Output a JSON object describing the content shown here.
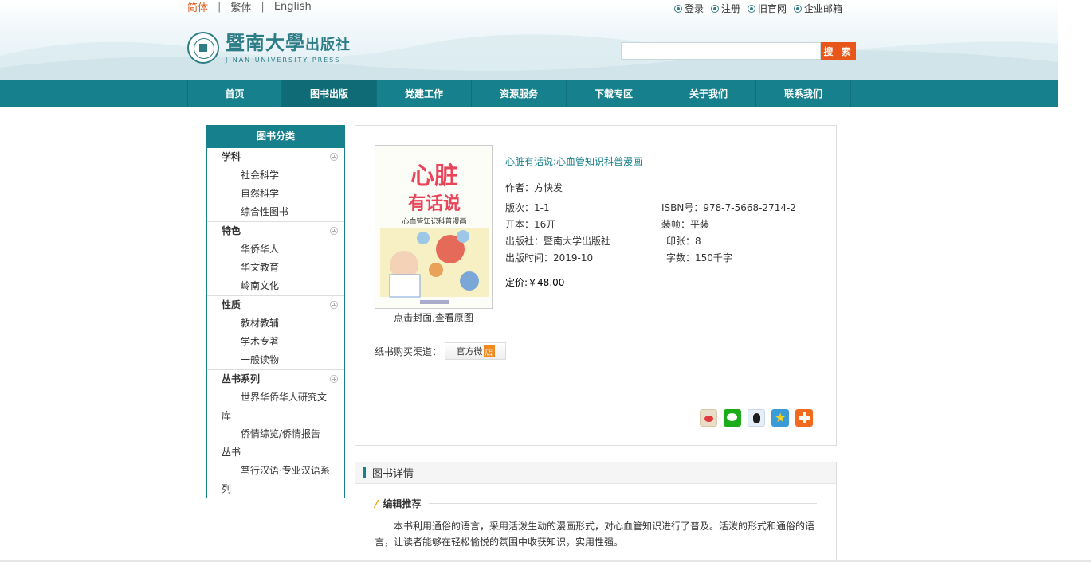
{
  "header": {
    "languages": [
      "简体",
      "繁体",
      "English"
    ],
    "active_language": "简体",
    "top_links": [
      {
        "label": "登录",
        "icon": "user-circle-icon"
      },
      {
        "label": "注册",
        "icon": "register-circle-icon"
      },
      {
        "label": "旧官网",
        "icon": "old-site-circle-icon"
      },
      {
        "label": "企业邮箱",
        "icon": "mail-circle-icon"
      }
    ],
    "logo_cn": "暨南大學",
    "logo_cn_small": "出版社",
    "logo_en": "JINAN UNIVERSITY PRESS",
    "search_placeholder": "",
    "search_button": "搜 索"
  },
  "nav": {
    "items": [
      "首页",
      "图书出版",
      "党建工作",
      "资源服务",
      "下载专区",
      "关于我们",
      "联系我们"
    ],
    "active": "图书出版"
  },
  "sidebar": {
    "title": "图书分类",
    "categories": [
      {
        "name": "学科",
        "items": [
          "社会科学",
          "自然科学",
          "综合性图书"
        ]
      },
      {
        "name": "特色",
        "items": [
          "华侨华人",
          "华文教育",
          "岭南文化"
        ]
      },
      {
        "name": "性质",
        "items": [
          "教材教辅",
          "学术专著",
          "一般读物"
        ]
      },
      {
        "name": "丛书系列",
        "items": [
          "世界华侨华人研究文库",
          "侨情综览/侨情报告丛书",
          "笃行汉语·专业汉语系列"
        ]
      }
    ]
  },
  "book": {
    "title": "心脏有话说:心血管知识科普漫画",
    "author": "作者：方快发",
    "edition": "版次：1-1",
    "isbn": "ISBN号：978-7-5668-2714-2",
    "format": "开本：16开",
    "binding": "装帧：平装",
    "publisher": "出版社：暨南大学出版社",
    "sheets": "印张：8",
    "pub_date": "出版时间：2019-10",
    "words": "字数：150千字",
    "price": "定价:￥48.00",
    "cover_caption": "点击封面,查看原图",
    "cover_title_1": "心脏",
    "cover_title_2": "有话说",
    "cover_subtitle": "心血管知识科普漫画",
    "buy_label": "纸书购买渠道：",
    "buy_button": "官方微",
    "buy_button_badge": "店",
    "share_icons": [
      "weibo-icon",
      "wechat-icon",
      "qq-icon",
      "qzone-icon",
      "more-share-icon"
    ]
  },
  "details": {
    "heading": "图书详情",
    "section_title": "编辑推荐",
    "section_slash": "/",
    "text": "本书利用通俗的语言，采用活泼生动的漫画形式，对心血管知识进行了普及。活泼的形式和通俗的语言，让读者能够在轻松愉悦的氛围中收获知识，实用性强。"
  },
  "colors": {
    "teal": "#16808c",
    "orange": "#e8561a"
  }
}
